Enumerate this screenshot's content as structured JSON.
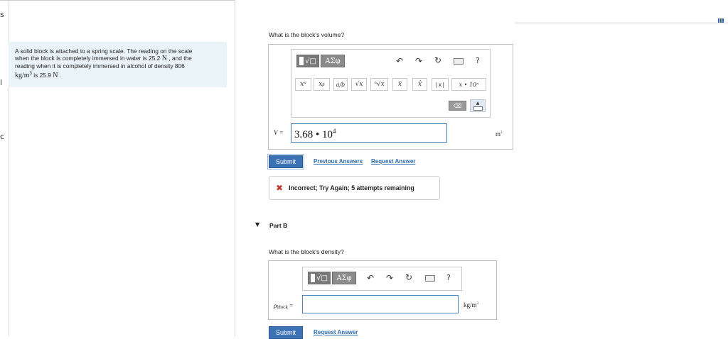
{
  "edge": {
    "marks": [
      "s",
      "l",
      "c"
    ]
  },
  "problem": {
    "line1": "A solid block is attached to a spring scale. The reading on the scale",
    "line2a": "when the block is completely immersed in water is 25.2 ",
    "line2u": "N",
    "line2b": " , and the",
    "line3": "reading when it is completely immersed in alcohol of density 806",
    "line4u": "kg/m",
    "line4sup": "3",
    "line4b": " is 25.9 ",
    "line4u2": "N",
    "line4c": " ."
  },
  "partA": {
    "question": "What is the block's volume?",
    "toolbar": {
      "greek_label": "ΑΣφ",
      "help": "?",
      "row2": [
        "xᵃ",
        "xᵦ",
        "a/b",
        "√x",
        "ⁿ√x",
        "x̅",
        "x̂",
        "|x|",
        "x • 10ⁿ"
      ]
    },
    "var_label": "V =",
    "answer_mantissa": "3.68 • 10",
    "answer_exp": "4",
    "unit": "m",
    "unit_sup": "3",
    "submit": "Submit",
    "previous_answers": "Previous Answers",
    "request_answer": "Request Answer",
    "feedback": "Incorrect; Try Again; 5 attempts remaining"
  },
  "partB": {
    "label": "Part B",
    "question": "What is the block's density?",
    "greek_label": "ΑΣφ",
    "help": "?",
    "var_main": "ρ",
    "var_sub": "block",
    "var_eq": " =",
    "unit": "kg/m",
    "unit_sup": "3",
    "submit": "Submit",
    "request_answer": "Request Answer"
  },
  "icons": [
    "undo-icon",
    "redo-icon",
    "reset-icon",
    "keyboard-icon",
    "help-icon",
    "backspace-icon",
    "keyboard-toggle-icon",
    "incorrect-x-icon",
    "collapse-triangle-icon"
  ],
  "colors": {
    "submit": "#3d72b5",
    "link": "#2c6bb0",
    "error": "#c0392b",
    "problem_bg": "#eaf4f8"
  }
}
